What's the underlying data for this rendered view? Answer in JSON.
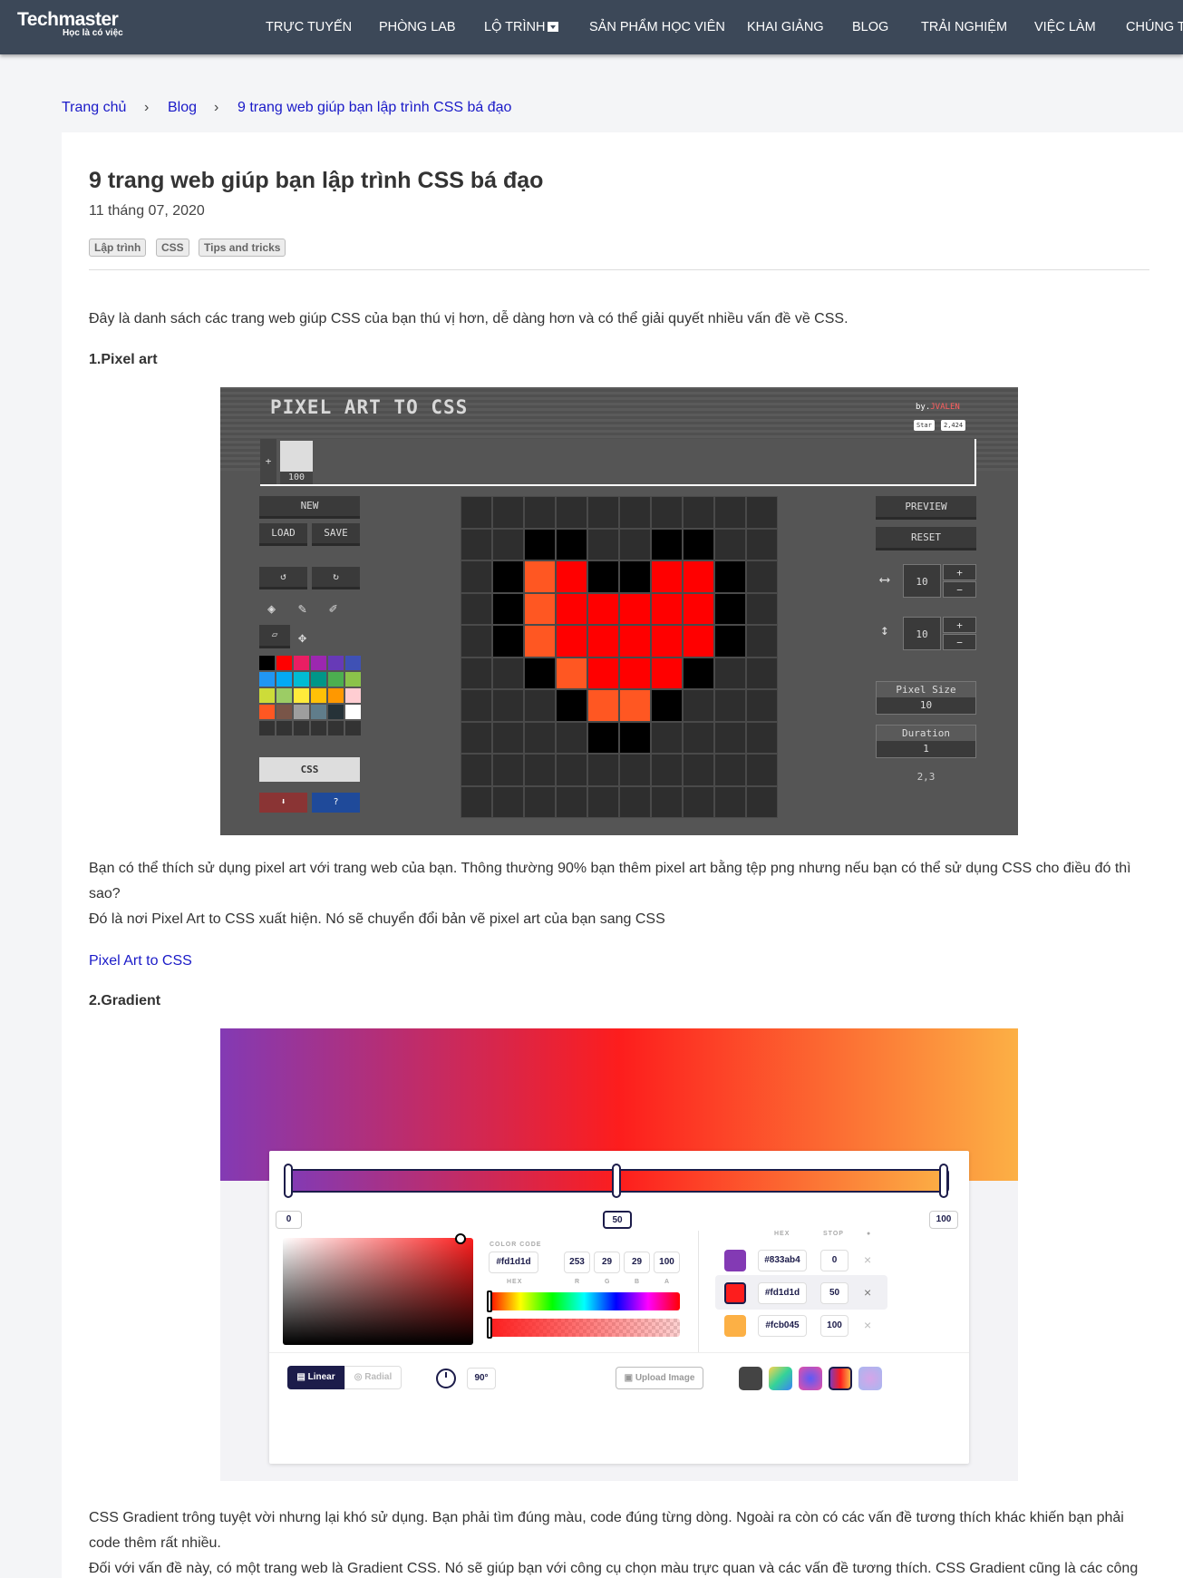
{
  "nav": {
    "logo": "Techmaster",
    "logo_sub": "Học là có việc",
    "items": [
      "TRỰC TUYẾN",
      "PHÒNG LAB",
      "LỘ TRÌNH",
      "SẢN PHẨM HỌC VIÊN",
      "KHAI GIẢNG",
      "BLOG",
      "TRẢI NGHIỆM",
      "VIỆC LÀM",
      "CHÚNG TÔI"
    ]
  },
  "breadcrumb": {
    "items": [
      "Trang chủ",
      "Blog",
      "9 trang web giúp bạn lập trình CSS bá đạo"
    ],
    "separator": "›"
  },
  "article": {
    "title": "9 trang web giúp bạn lập trình CSS bá đạo",
    "date": "11 tháng 07, 2020",
    "tags": [
      "Lập trình",
      "CSS",
      "Tips and tricks"
    ],
    "intro": "Đây là danh sách các trang web giúp CSS của bạn thú vị hơn, dễ dàng hơn và có thể giải quyết nhiều vấn đề về CSS.",
    "section1": {
      "heading": "1.Pixel art",
      "para1": "Bạn có thể thích sử dụng pixel art với trang web của bạn. Thông thường 90% bạn thêm pixel art bằng tệp png nhưng nếu bạn có thể sử dụng CSS cho điều đó thì sao?",
      "para2": "Đó là nơi Pixel Art to CSS xuất hiện. Nó sẽ chuyển đổi bản vẽ pixel art của bạn sang CSS",
      "link": "Pixel Art to CSS"
    },
    "section2": {
      "heading": "2.Gradient",
      "para1": "CSS Gradient trông tuyệt vời nhưng lại khó sử dụng. Bạn phải tìm đúng màu, code đúng từng dòng. Ngoài ra còn có các vấn đề tương thích khác khiến bạn phải code thêm rất nhiều.",
      "para2": "Đối với vấn đề này, có một trang web là Gradient CSS. Nó sẽ giúp bạn với công cụ chọn màu trực quan và các vấn đề tương thích. CSS Gradient cũng là các công"
    }
  },
  "pixel_art_app": {
    "title": "PIXEL ART TO CSS",
    "by": "by.",
    "author": "JVALEN",
    "star": "Star",
    "star_count": "2,424",
    "frame_add": "+",
    "frame_value": "100",
    "btn_new": "NEW",
    "btn_load": "LOAD",
    "btn_save": "SAVE",
    "btn_css": "CSS",
    "btn_download": "⬇",
    "btn_help": "?",
    "btn_preview": "PREVIEW",
    "btn_reset": "RESET",
    "width": "10",
    "height": "10",
    "plus": "+",
    "minus": "−",
    "pixel_size_label": "Pixel Size",
    "pixel_size": "10",
    "duration_label": "Duration",
    "duration": "1",
    "coords": "2,3",
    "palette": [
      "#000000",
      "#ff0000",
      "#e91e63",
      "#9c27b0",
      "#673ab7",
      "#3f51b5",
      "#2196f3",
      "#03a9f4",
      "#00bcd4",
      "#009688",
      "#4caf50",
      "#8bc34a",
      "#cddc39",
      "#9ccc65",
      "#ffeb3b",
      "#ffc107",
      "#ff9800",
      "#ffcdd2",
      "#ff5722",
      "#795548",
      "#9e9e9e",
      "#607d8b",
      "#263238",
      "#ffffff",
      "#333333",
      "#333333",
      "#333333",
      "#333333",
      "#333333",
      "#333333"
    ],
    "grid": [
      "..........",
      "..XX..XX..",
      ".XORXXRRX.",
      ".XORRRRRX.",
      ".XORRRRRX.",
      "..XORRRX..",
      "...XOOX...",
      "....XX....",
      "..........",
      ".........."
    ],
    "grid_colors": {
      ".": "#2e2e2e",
      "X": "#000000",
      "O": "#ff5722",
      "R": "#ff0000"
    }
  },
  "gradient_app": {
    "stop_left": "0",
    "stop_mid": "50",
    "stop_right": "100",
    "color_code_label": "COLOR CODE",
    "hex": "#fd1d1d",
    "r": "253",
    "g": "29",
    "b": "29",
    "a": "100",
    "lbl_hex": "HEX",
    "lbl_r": "R",
    "lbl_g": "G",
    "lbl_b": "B",
    "lbl_a": "A",
    "col_hex": "HEX",
    "col_stop": "STOP",
    "stops": [
      {
        "hex": "#833ab4",
        "stop": "0",
        "color": "#833ab4"
      },
      {
        "hex": "#fd1d1d",
        "stop": "50",
        "color": "#fd1d1d"
      },
      {
        "hex": "#fcb045",
        "stop": "100",
        "color": "#fcb045"
      }
    ],
    "remove": "×",
    "linear": "Linear",
    "radial": "Radial",
    "angle": "90°",
    "upload": "Upload Image"
  }
}
